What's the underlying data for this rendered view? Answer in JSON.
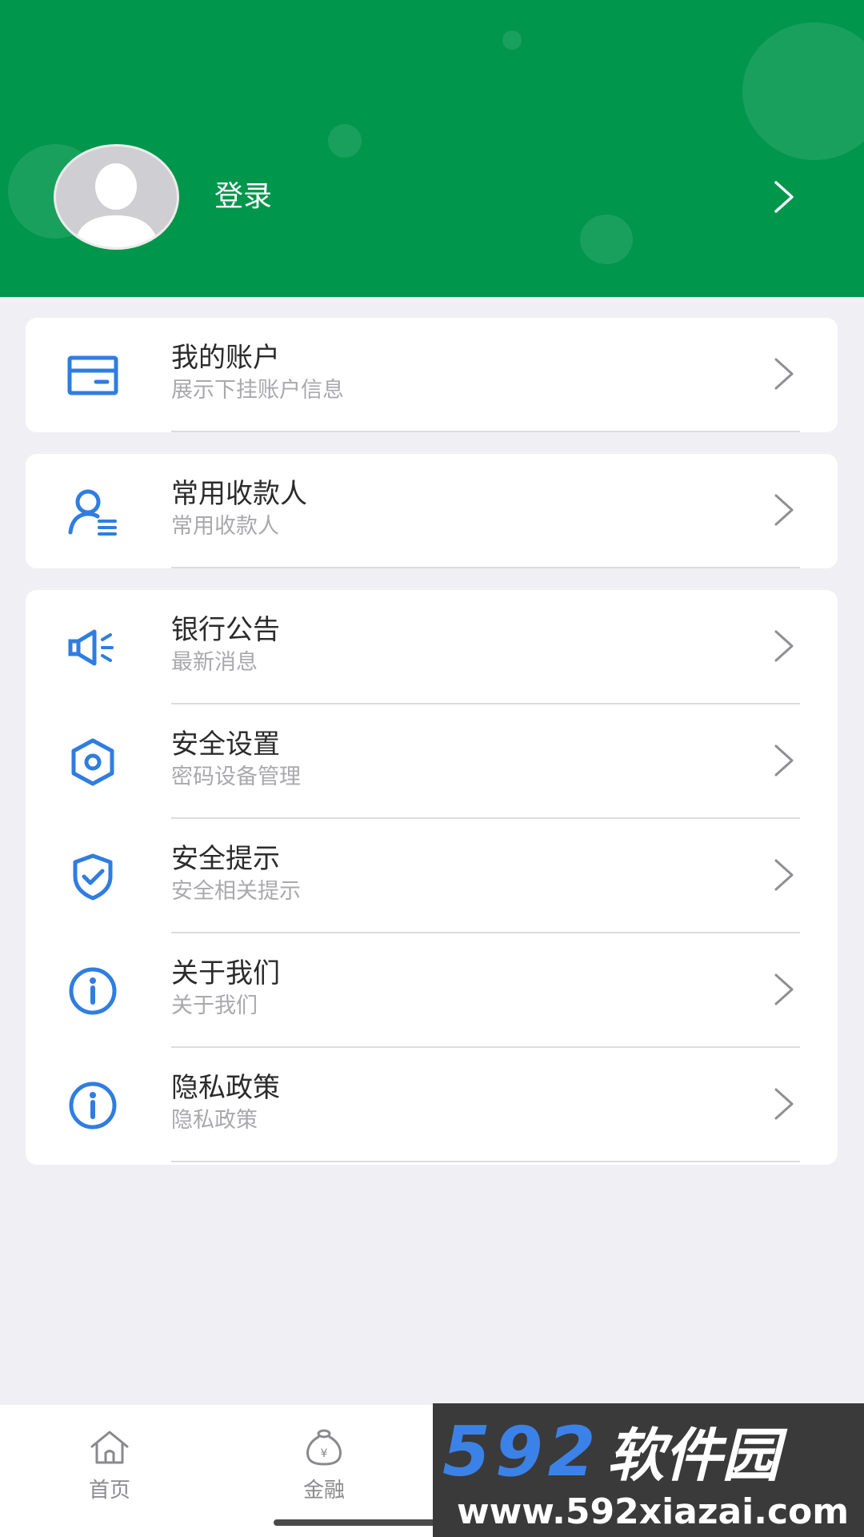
{
  "header": {
    "login_label": "登录"
  },
  "menu": {
    "group1": [
      {
        "title": "我的账户",
        "subtitle": "展示下挂账户信息",
        "icon": "card-icon"
      }
    ],
    "group2": [
      {
        "title": "常用收款人",
        "subtitle": "常用收款人",
        "icon": "payee-icon"
      }
    ],
    "group3": [
      {
        "title": "银行公告",
        "subtitle": "最新消息",
        "icon": "megaphone-icon"
      },
      {
        "title": "安全设置",
        "subtitle": "密码设备管理",
        "icon": "hexagon-settings-icon"
      },
      {
        "title": "安全提示",
        "subtitle": "安全相关提示",
        "icon": "shield-check-icon"
      },
      {
        "title": "关于我们",
        "subtitle": "关于我们",
        "icon": "info-icon"
      },
      {
        "title": "隐私政策",
        "subtitle": "隐私政策",
        "icon": "info-icon"
      }
    ]
  },
  "tabbar": {
    "tabs": [
      {
        "label": "首页",
        "icon": "home-icon"
      },
      {
        "label": "金融",
        "icon": "money-bag-icon"
      }
    ]
  },
  "watermark": {
    "brand_number": "592",
    "brand_name": "软件园",
    "url": "www.592xiazai.com"
  },
  "colors": {
    "header_green": "#00964b",
    "icon_blue": "#2f7de1",
    "page_background": "#f0eff4"
  }
}
